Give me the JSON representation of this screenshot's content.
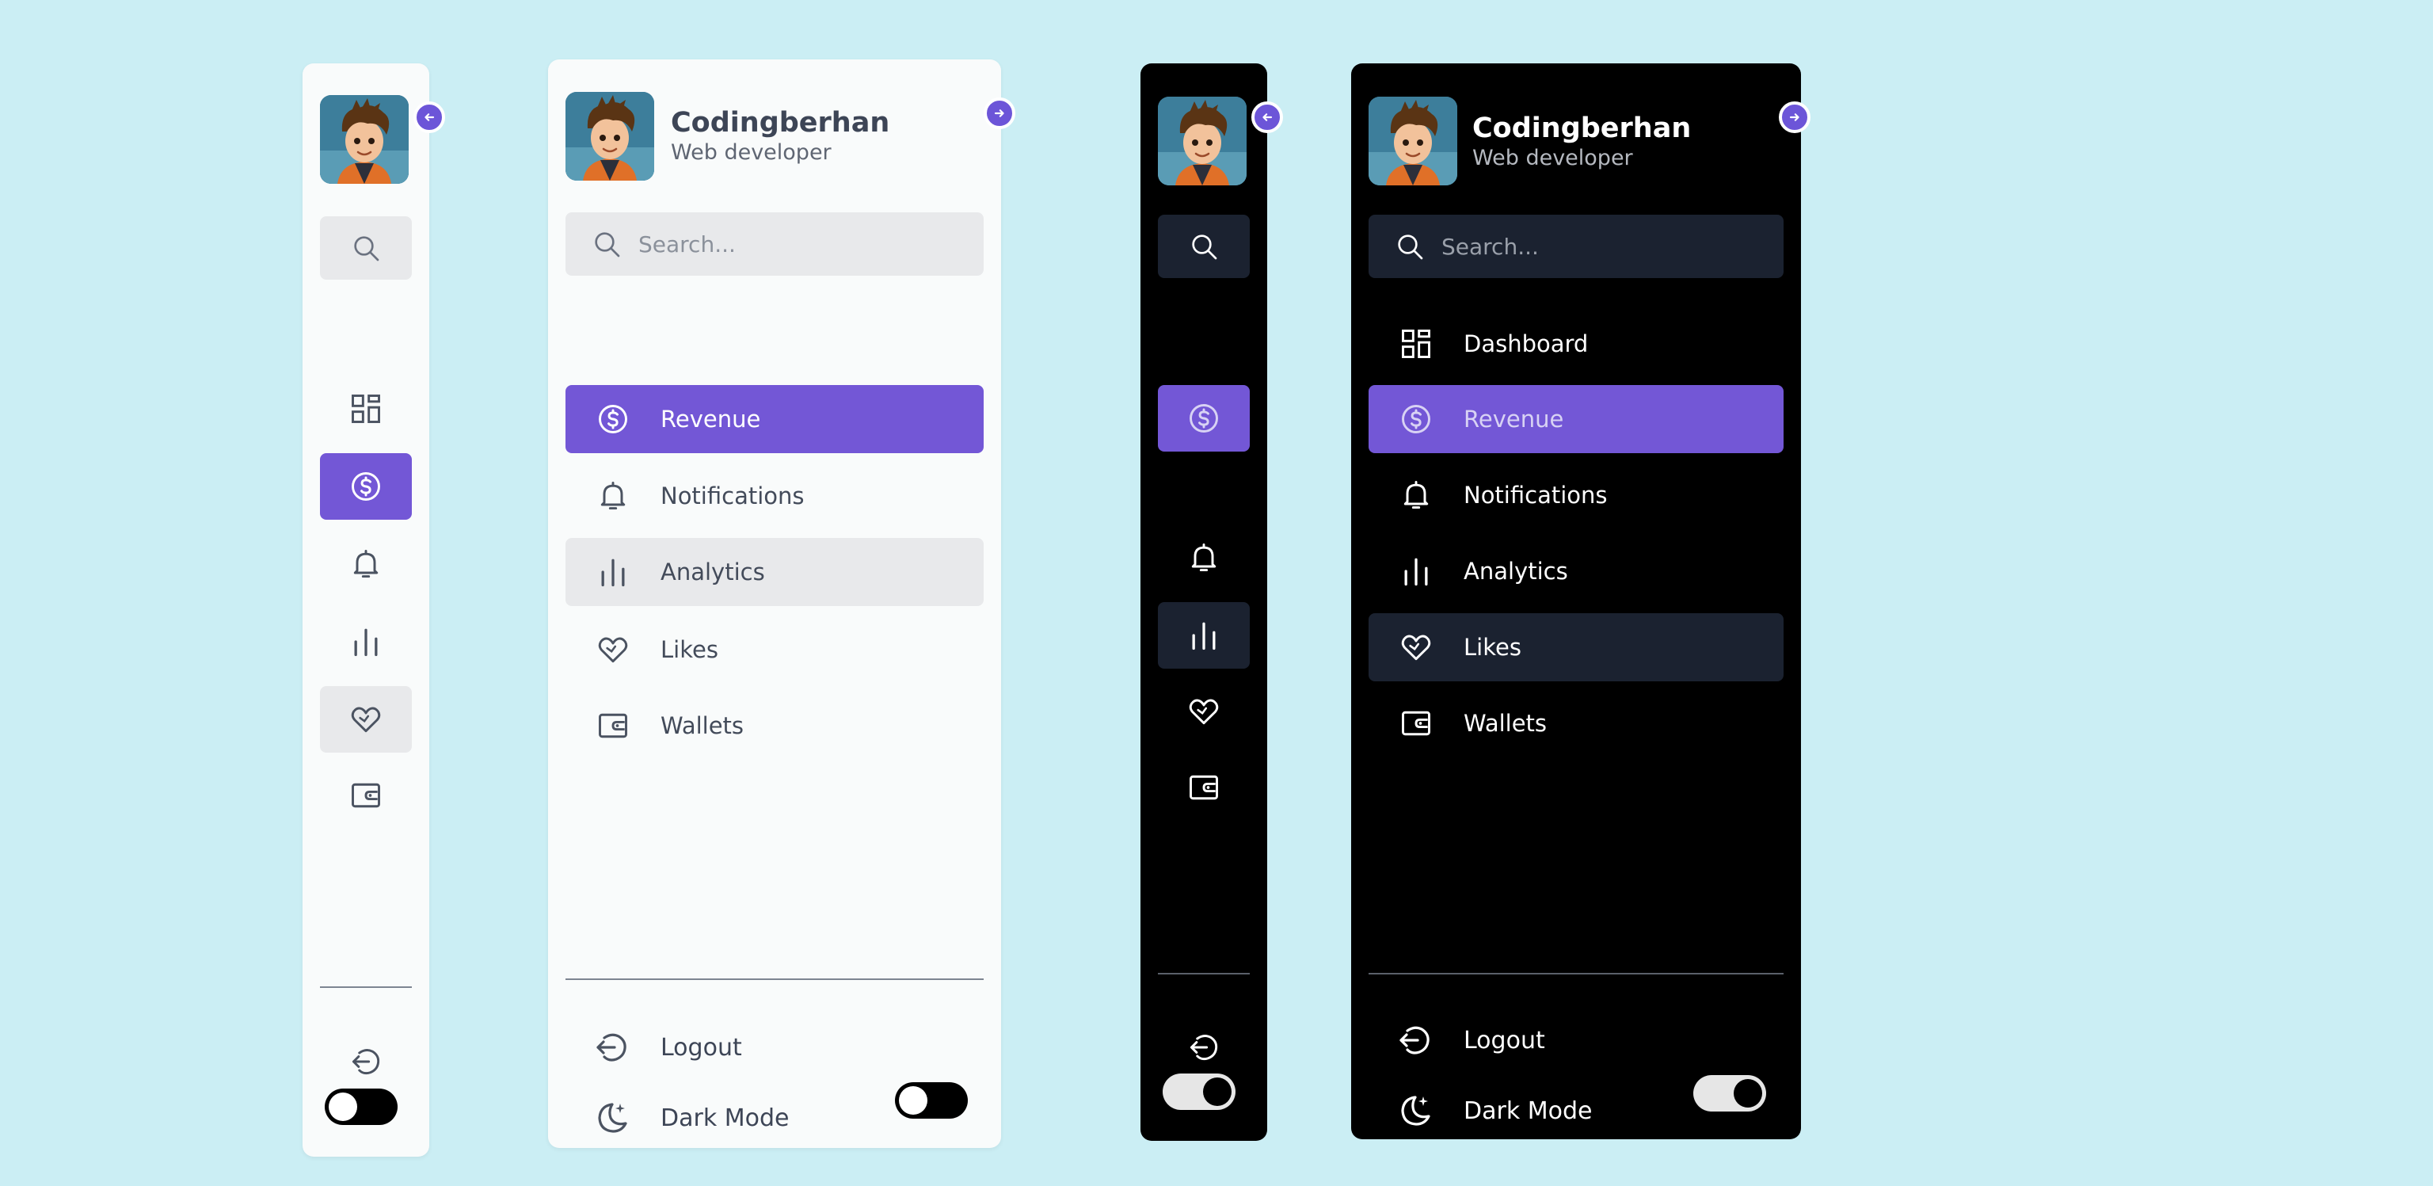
{
  "profile": {
    "name": "Codingberhan",
    "role": "Web developer"
  },
  "search": {
    "placeholder": "Search..."
  },
  "menu": [
    {
      "label": "Dashboard",
      "icon": "dashboard-icon"
    },
    {
      "label": "Revenue",
      "icon": "dollar-circle-icon"
    },
    {
      "label": "Notifications",
      "icon": "bell-icon"
    },
    {
      "label": "Analytics",
      "icon": "bar-chart-icon"
    },
    {
      "label": "Likes",
      "icon": "heart-icon"
    },
    {
      "label": "Wallets",
      "icon": "wallet-icon"
    }
  ],
  "bottom": {
    "logout": "Logout",
    "dark_mode": "Dark Mode"
  },
  "colors": {
    "background": "#cbeef4",
    "accent": "#7357d6",
    "light_panel": "#f9fbfb",
    "dark_panel": "#000000",
    "hover_light": "#e8e9eb",
    "hover_dark": "#1b2230"
  }
}
